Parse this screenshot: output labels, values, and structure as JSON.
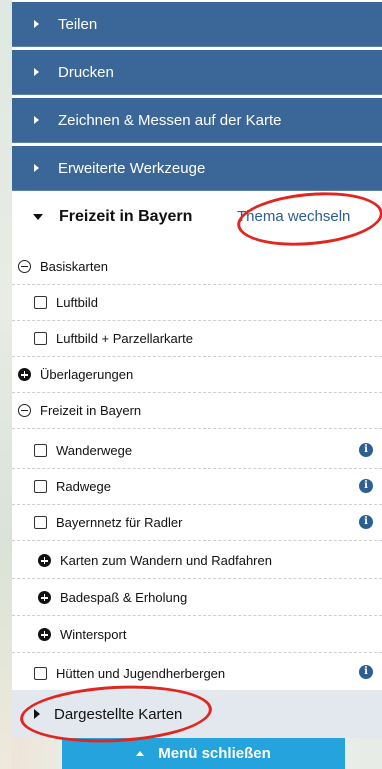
{
  "menu": {
    "items": [
      "Teilen",
      "Drucken",
      "Zeichnen & Messen auf der Karte",
      "Erweiterte Werkzeuge"
    ]
  },
  "freizeit": {
    "title": "Freizeit in Bayern",
    "change_theme": "Thema wechseln"
  },
  "layers": {
    "basiskarten": "Basiskarten",
    "luftbild": "Luftbild",
    "luftbild_parzellar": "Luftbild + Parzellarkarte",
    "ueberlagerungen": "Überlagerungen",
    "freizeit_group": "Freizeit in Bayern",
    "wanderwege": "Wanderwege",
    "radwege": "Radwege",
    "bayernnetz": "Bayernnetz für Radler",
    "karten_wandern": "Karten zum Wandern und Radfahren",
    "badespass": "Badespaß & Erholung",
    "wintersport": "Wintersport",
    "huetten": "Hütten und Jugendherbergen"
  },
  "info_icon_glyph": "i",
  "dargestellte": "Dargestellte Karten",
  "close_menu": "Menü schließen",
  "colors": {
    "menu_bg": "#3a6797",
    "link": "#2b5d93",
    "close_button": "#25a3dc",
    "annotation_ring": "#e0261f"
  }
}
